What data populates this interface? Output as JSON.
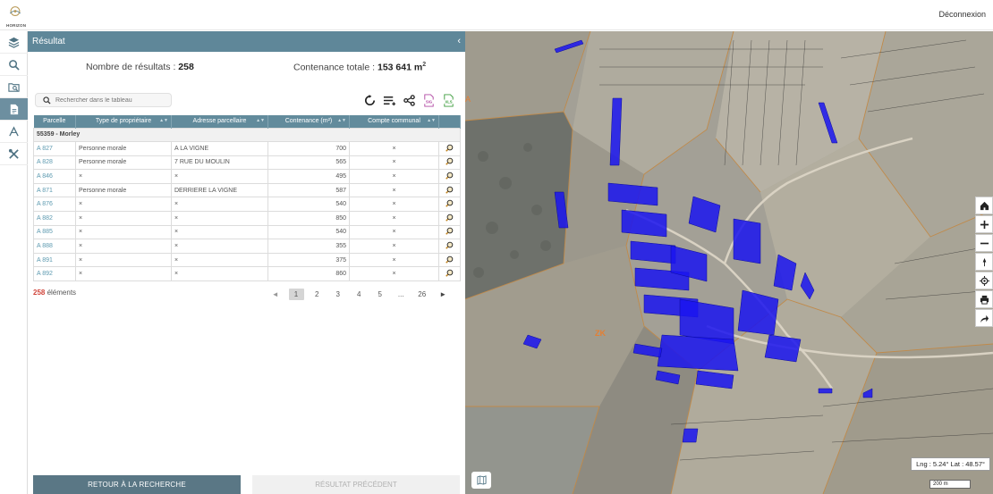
{
  "header": {
    "logo_text": "HORIZON",
    "logout_label": "Déconnexion"
  },
  "rail": {
    "items": [
      {
        "icon": "layers-icon",
        "active": false
      },
      {
        "icon": "search-icon",
        "active": false
      },
      {
        "icon": "folder-search-icon",
        "active": false
      },
      {
        "icon": "document-icon",
        "active": true
      },
      {
        "icon": "measure-icon",
        "active": false
      },
      {
        "icon": "tools-icon",
        "active": false
      }
    ]
  },
  "panel": {
    "title": "Résultat",
    "collapse_label": "‹",
    "results_label": "Nombre de résultats : ",
    "results_count": "258",
    "area_label": "Contenance totale : ",
    "area_value": "153 641 m",
    "area_unit_sup": "2",
    "search_placeholder": "Rechercher dans le tableau",
    "tools": [
      "reset-icon",
      "columns-icon",
      "share-icon",
      "sig-export-icon",
      "xls-export-icon"
    ],
    "tool_labels": {
      "sig": "SIG",
      "xls": "XLS"
    }
  },
  "table": {
    "columns": [
      "Parcelle",
      "Type de propriétaire",
      "Adresse parcellaire",
      "Contenance (m²)",
      "Compte communal"
    ],
    "group": "55359 - Morley",
    "rows": [
      {
        "parcelle": "A 827",
        "type": "Personne morale",
        "adresse": "A LA VIGNE",
        "contenance": "700",
        "compte": "×"
      },
      {
        "parcelle": "A 828",
        "type": "Personne morale",
        "adresse": "7 RUE DU MOULIN",
        "contenance": "565",
        "compte": "×"
      },
      {
        "parcelle": "A 846",
        "type": "×",
        "adresse": "×",
        "contenance": "495",
        "compte": "×"
      },
      {
        "parcelle": "A 871",
        "type": "Personne morale",
        "adresse": "DERRIERE LA VIGNE",
        "contenance": "587",
        "compte": "×"
      },
      {
        "parcelle": "A 876",
        "type": "×",
        "adresse": "×",
        "contenance": "540",
        "compte": "×"
      },
      {
        "parcelle": "A 882",
        "type": "×",
        "adresse": "×",
        "contenance": "850",
        "compte": "×"
      },
      {
        "parcelle": "A 885",
        "type": "×",
        "adresse": "×",
        "contenance": "540",
        "compte": "×"
      },
      {
        "parcelle": "A 888",
        "type": "×",
        "adresse": "×",
        "contenance": "355",
        "compte": "×"
      },
      {
        "parcelle": "A 891",
        "type": "×",
        "adresse": "×",
        "contenance": "375",
        "compte": "×"
      },
      {
        "parcelle": "A 892",
        "type": "×",
        "adresse": "×",
        "contenance": "860",
        "compte": "×"
      }
    ]
  },
  "pagination": {
    "total": "258",
    "total_suffix": " éléments",
    "pages": [
      "1",
      "2",
      "3",
      "4",
      "5",
      "...",
      "26"
    ],
    "current": "1",
    "prev": "◄",
    "next": "►"
  },
  "footer": {
    "back_label": "RETOUR À LA RECHERCHE",
    "prev_label": "RÉSULTAT PRÉCÉDENT"
  },
  "map": {
    "zone_label": "ZK",
    "edge_label": "A",
    "coords_text": "Lng : 5.24°   Lat : 48.57°",
    "scale_text": "200 m",
    "controls": [
      "home-icon",
      "zoom-in-icon",
      "zoom-out-icon",
      "north-icon",
      "locate-icon",
      "print-icon",
      "share-arrow-icon"
    ],
    "colors": {
      "parcel": "#1a14f0",
      "field": "#a19e93",
      "forest": "#6f726c",
      "boundary": "#c08a4a"
    }
  }
}
